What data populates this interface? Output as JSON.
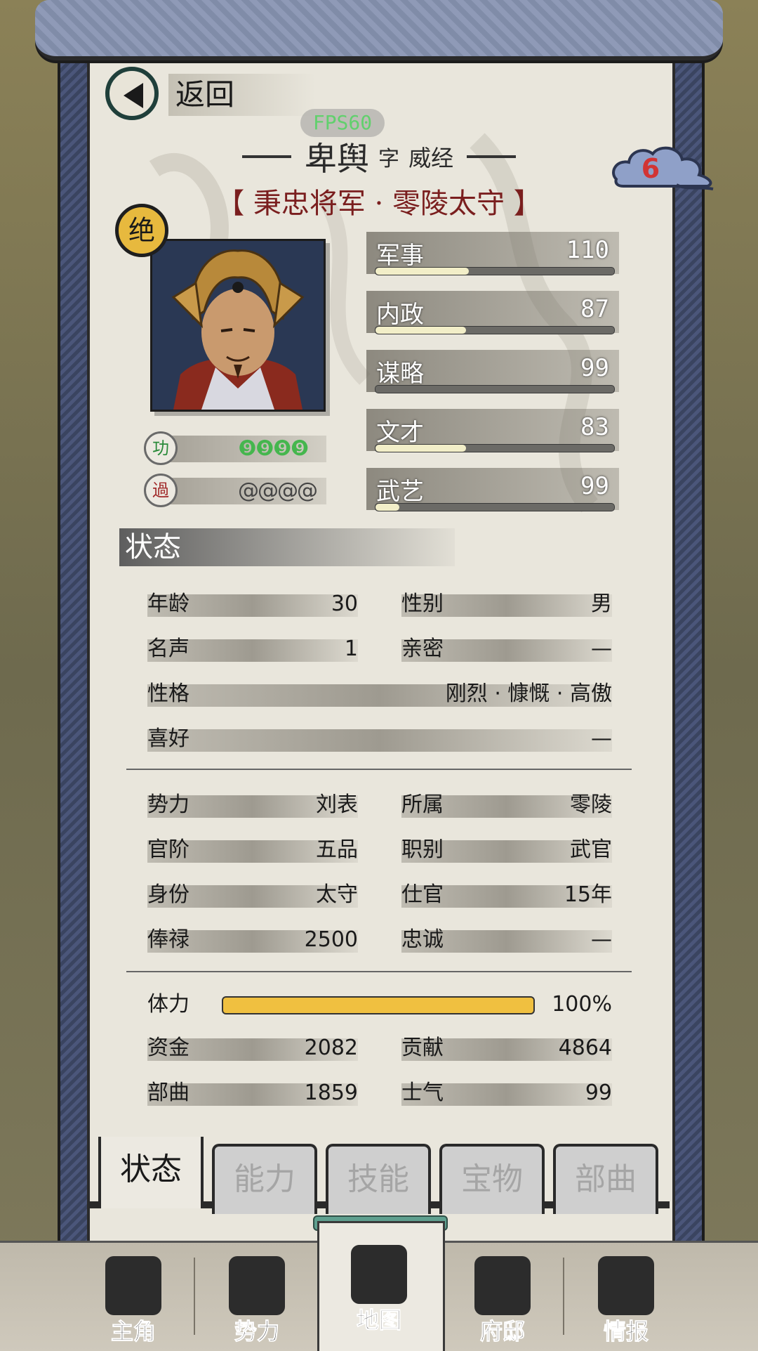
{
  "hud": {
    "fps": "FPS60"
  },
  "header": {
    "back_label": "返回",
    "notification_count": "6"
  },
  "character": {
    "name": "卑舆",
    "zi_label": "字",
    "courtesy_name": "威经",
    "title": "【 秉忠将军 · 零陵太守 】",
    "rank_badge": "绝",
    "merit_label": "功",
    "demerit_label": "過",
    "merit_pips": "❾❾❾❾",
    "demerit_pips": "@@@@"
  },
  "attributes": [
    {
      "label": "军事",
      "value": "110",
      "bar_fraction": 0.39
    },
    {
      "label": "内政",
      "value": "87",
      "bar_fraction": 0.38
    },
    {
      "label": "谋略",
      "value": "99",
      "bar_fraction": 0.0
    },
    {
      "label": "文才",
      "value": "83",
      "bar_fraction": 0.38
    },
    {
      "label": "武艺",
      "value": "99",
      "bar_fraction": 0.1
    }
  ],
  "status": {
    "heading": "状态",
    "age_label": "年龄",
    "age": "30",
    "gender_label": "性别",
    "gender": "男",
    "fame_label": "名声",
    "fame": "1",
    "intimacy_label": "亲密",
    "intimacy": "—",
    "personality_label": "性格",
    "personality": "刚烈 · 慷慨 · 高傲",
    "hobby_label": "喜好",
    "hobby": "—"
  },
  "affiliation": {
    "faction_label": "势力",
    "faction": "刘表",
    "belong_label": "所属",
    "belong": "零陵",
    "rank_label": "官阶",
    "rank": "五品",
    "post_label": "职别",
    "post": "武官",
    "identity_label": "身份",
    "identity": "太守",
    "service_label": "仕官",
    "service": "15年",
    "salary_label": "俸禄",
    "salary": "2500",
    "loyalty_label": "忠诚",
    "loyalty": "—"
  },
  "resources": {
    "stamina_label": "体力",
    "stamina": "100%",
    "stamina_fraction": 1.0,
    "funds_label": "资金",
    "funds": "2082",
    "contribution_label": "贡献",
    "contribution": "4864",
    "troops_label": "部曲",
    "troops": "1859",
    "morale_label": "士气",
    "morale": "99"
  },
  "tabs": [
    {
      "label": "状态",
      "active": true
    },
    {
      "label": "能力",
      "active": false
    },
    {
      "label": "技能",
      "active": false
    },
    {
      "label": "宝物",
      "active": false
    },
    {
      "label": "部曲",
      "active": false
    }
  ],
  "bottom_nav": [
    {
      "label": "主角",
      "icon": "general-icon"
    },
    {
      "label": "势力",
      "icon": "banner-flag-icon"
    },
    {
      "label": "地图",
      "icon": "map-icon"
    },
    {
      "label": "府邸",
      "icon": "mansion-icon"
    },
    {
      "label": "情报",
      "icon": "scroll-report-icon"
    }
  ]
}
